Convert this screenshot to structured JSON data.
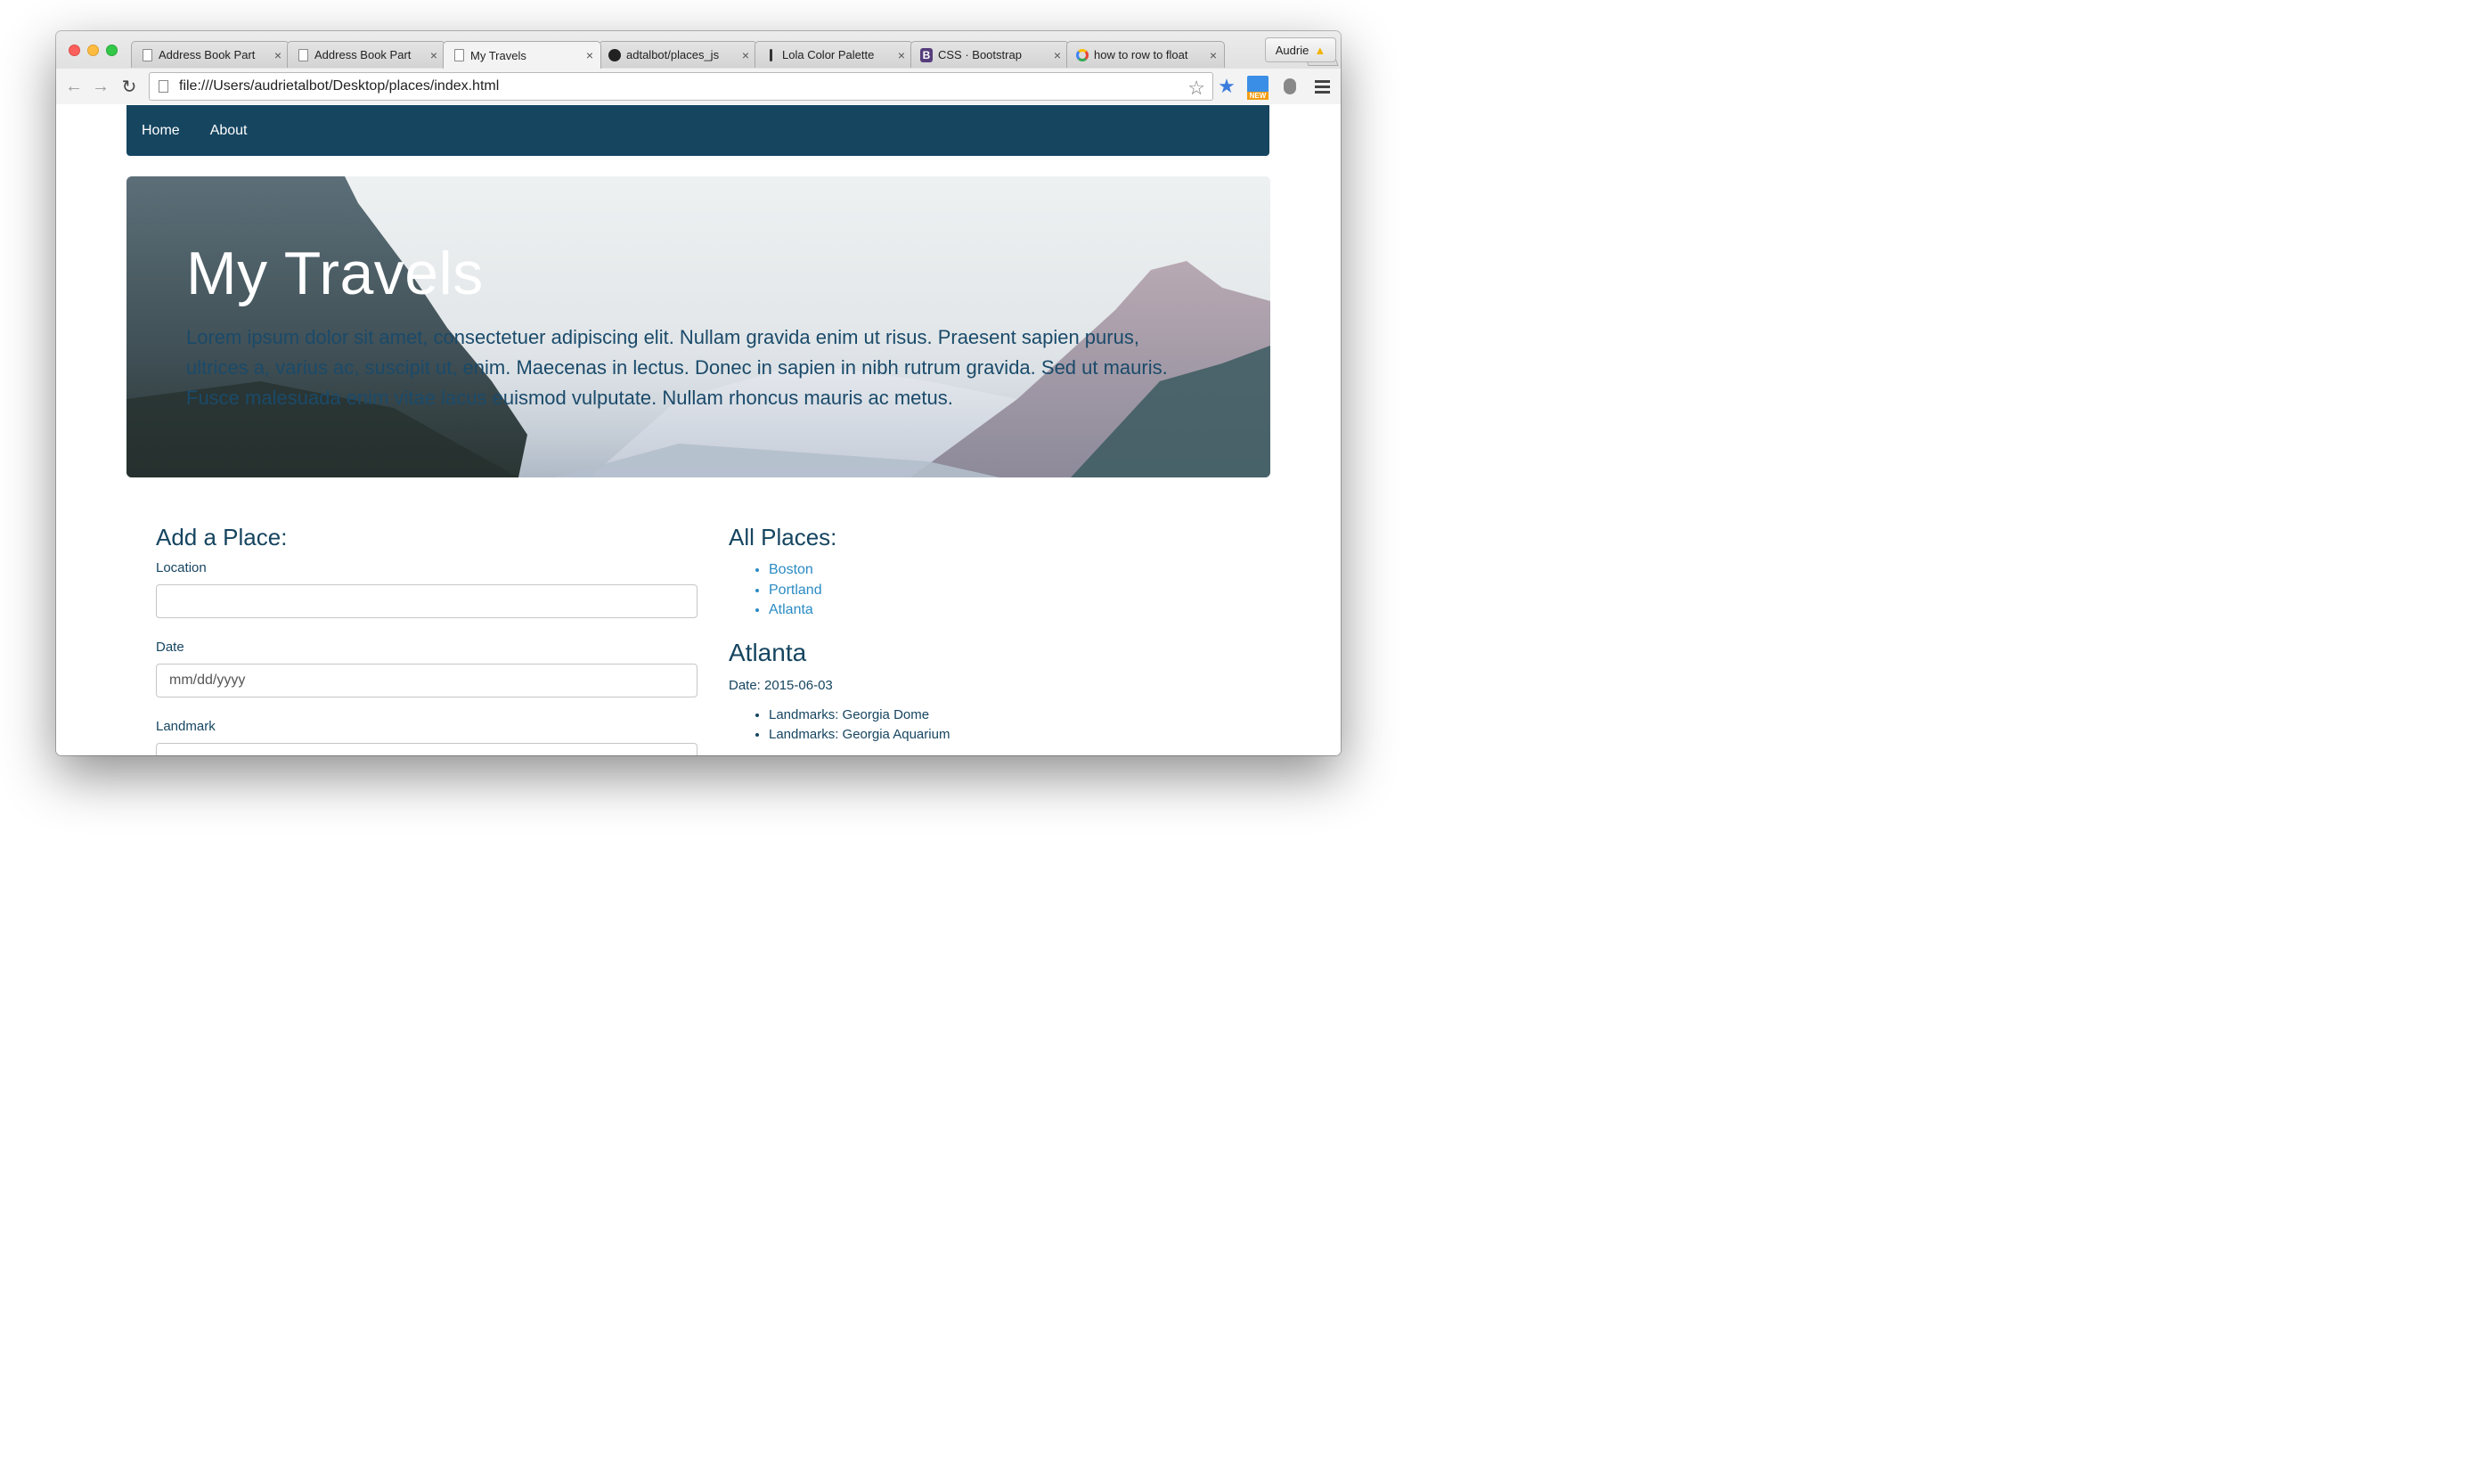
{
  "browser": {
    "tabs": [
      {
        "title": "Address Book Part",
        "icon": "document-icon"
      },
      {
        "title": "Address Book Part",
        "icon": "document-icon"
      },
      {
        "title": "My Travels",
        "icon": "document-icon",
        "active": true
      },
      {
        "title": "adtalbot/places_js",
        "icon": "github-icon"
      },
      {
        "title": "Lola Color Palette",
        "icon": "pipette-icon"
      },
      {
        "title": "CSS · Bootstrap",
        "icon": "bootstrap-icon"
      },
      {
        "title": "how to row to float",
        "icon": "google-icon"
      }
    ],
    "tab_close_glyph": "×",
    "profile_name": "Audrie",
    "address": "file:///Users/audrietalbot/Desktop/places/index.html",
    "ext_new_label": "NEW"
  },
  "nav": {
    "home": "Home",
    "about": "About"
  },
  "hero": {
    "title": "My Travels",
    "text": "Lorem ipsum dolor sit amet, consectetuer adipiscing elit. Nullam gravida enim ut risus. Praesent sapien purus, ultrices a, varius ac, suscipit ut, enim. Maecenas in lectus. Donec in sapien in nibh rutrum gravida. Sed ut mauris. Fusce malesuada enim vitae lacus euismod vulputate. Nullam rhoncus mauris ac metus."
  },
  "form": {
    "heading": "Add a Place:",
    "location_label": "Location",
    "location_value": "",
    "date_label": "Date",
    "date_placeholder": "mm/dd/yyyy",
    "landmark_label": "Landmark",
    "landmark_value": ""
  },
  "places": {
    "heading": "All Places:",
    "items": [
      "Boston",
      "Portland",
      "Atlanta"
    ],
    "selected": {
      "name": "Atlanta",
      "date": "Date: 2015-06-03",
      "landmarks": [
        "Landmarks: Georgia Dome",
        "Landmarks: Georgia Aquarium"
      ]
    }
  },
  "colors": {
    "navbar": "#164560",
    "link": "#2a8bc4",
    "heading": "#164560"
  }
}
